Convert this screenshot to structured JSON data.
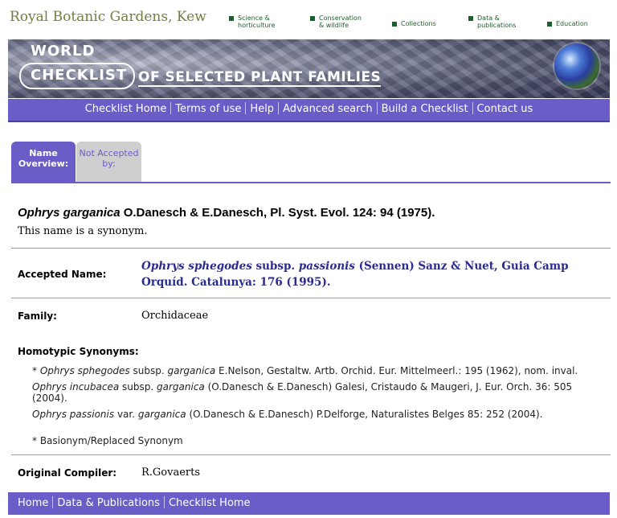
{
  "org": {
    "name": "Royal Botanic Gardens, Kew"
  },
  "top_nav": [
    {
      "label": "Science & horticulture"
    },
    {
      "label": "Conservation & wildlife"
    },
    {
      "label": "Collections"
    },
    {
      "label": "Data & publications"
    },
    {
      "label": "Education"
    }
  ],
  "banner": {
    "line1": "WORLD",
    "line2": "CHECKLIST",
    "line3": "OF SELECTED PLANT FAMILIES"
  },
  "nav": [
    {
      "label": "Checklist Home"
    },
    {
      "label": "Terms of use"
    },
    {
      "label": "Help"
    },
    {
      "label": "Advanced search"
    },
    {
      "label": "Build a Checklist"
    },
    {
      "label": "Contact us"
    }
  ],
  "tabs": [
    {
      "label": "Name Overview:"
    },
    {
      "label": "Not Accepted by:"
    }
  ],
  "record": {
    "name_italic": "Ophrys garganica",
    "name_rest": " O.Danesch & E.Danesch, Pl. Syst. Evol. 124: 94 (1975).",
    "status_text": "This name is a synonym.",
    "accepted_label": "Accepted Name:",
    "accepted_italic1": "Ophrys sphegodes",
    "accepted_mid": " subsp. ",
    "accepted_italic2": "passionis",
    "accepted_rest": " (Sennen) Sanz & Nuet, Guia Camp Orquíd. Catalunya: 176 (1995).",
    "family_label": "Family:",
    "family": "Orchidaceae",
    "homotypic_label": "Homotypic Synonyms:",
    "homotypic": [
      {
        "prefix": "* ",
        "genus_sp": "Ophrys sphegodes",
        "rank": " subsp. ",
        "infra": "garganica",
        "rest": " E.Nelson, Gestaltw. Artb. Orchid. Eur. Mittelmeerl.: 195 (1962), nom. inval."
      },
      {
        "prefix": "",
        "genus_sp": "Ophrys incubacea",
        "rank": " subsp. ",
        "infra": "garganica",
        "rest": " (O.Danesch & E.Danesch) Galesi, Cristaudo & Maugeri, J. Eur. Orch. 36: 505 (2004)."
      },
      {
        "prefix": "",
        "genus_sp": "Ophrys passionis",
        "rank": " var. ",
        "infra": "garganica",
        "rest": " (O.Danesch & E.Danesch) P.Delforge, Naturalistes Belges 85: 252 (2004)."
      }
    ],
    "basionym_note": "* Basionym/Replaced Synonym",
    "compiler_label": "Original Compiler:",
    "compiler": "R.Govaerts"
  },
  "footer": [
    {
      "label": "Home"
    },
    {
      "label": "Data & Publications"
    },
    {
      "label": "Checklist Home"
    }
  ],
  "colors": {
    "nav_purple": "#6a5dc7",
    "kew_green": "#6f7f3f",
    "accepted_blue": "#2b2b8f"
  }
}
